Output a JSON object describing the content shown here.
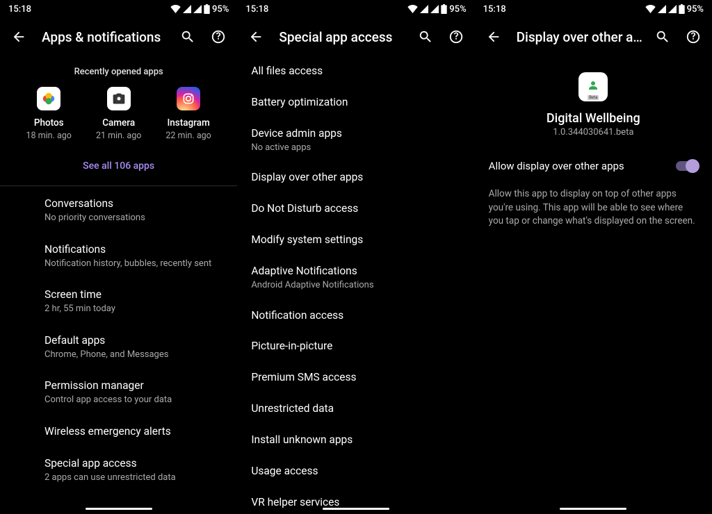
{
  "status": {
    "time": "15:18",
    "battery": "95%"
  },
  "screen1": {
    "title": "Apps & notifications",
    "recently_label": "Recently opened apps",
    "apps": [
      {
        "name": "Photos",
        "sub": "18 min. ago"
      },
      {
        "name": "Camera",
        "sub": "21 min. ago"
      },
      {
        "name": "Instagram",
        "sub": "22 min. ago"
      }
    ],
    "see_all": "See all 106 apps",
    "items": [
      {
        "title": "Conversations",
        "sub": "No priority conversations"
      },
      {
        "title": "Notifications",
        "sub": "Notification history, bubbles, recently sent"
      },
      {
        "title": "Screen time",
        "sub": "2 hr, 55 min today"
      },
      {
        "title": "Default apps",
        "sub": "Chrome, Phone, and Messages"
      },
      {
        "title": "Permission manager",
        "sub": "Control app access to your data"
      },
      {
        "title": "Wireless emergency alerts",
        "sub": ""
      },
      {
        "title": "Special app access",
        "sub": "2 apps can use unrestricted data"
      }
    ]
  },
  "screen2": {
    "title": "Special app access",
    "items": [
      {
        "title": "All files access",
        "sub": ""
      },
      {
        "title": "Battery optimization",
        "sub": ""
      },
      {
        "title": "Device admin apps",
        "sub": "No active apps"
      },
      {
        "title": "Display over other apps",
        "sub": ""
      },
      {
        "title": "Do Not Disturb access",
        "sub": ""
      },
      {
        "title": "Modify system settings",
        "sub": ""
      },
      {
        "title": "Adaptive Notifications",
        "sub": "Android Adaptive Notifications"
      },
      {
        "title": "Notification access",
        "sub": ""
      },
      {
        "title": "Picture-in-picture",
        "sub": ""
      },
      {
        "title": "Premium SMS access",
        "sub": ""
      },
      {
        "title": "Unrestricted data",
        "sub": ""
      },
      {
        "title": "Install unknown apps",
        "sub": ""
      },
      {
        "title": "Usage access",
        "sub": ""
      },
      {
        "title": "VR helper services",
        "sub": ""
      }
    ]
  },
  "screen3": {
    "title": "Display over other a…",
    "app_name": "Digital Wellbeing",
    "app_version": "1.0.344030641.beta",
    "beta_label": "Beta",
    "toggle_label": "Allow display over other apps",
    "toggle_on": true,
    "description": "Allow this app to display on top of other apps you're using. This app will be able to see where you tap or change what's displayed on the screen."
  }
}
